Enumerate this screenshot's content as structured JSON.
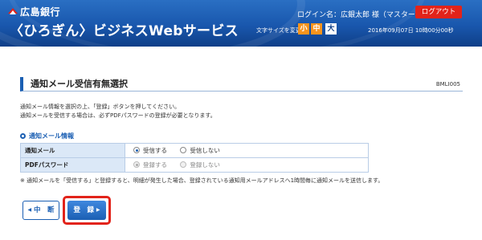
{
  "header": {
    "bank_name": "広島銀行",
    "service_name": "〈ひろぎん〉ビジネスWebサービス",
    "login_info": "ログイン名：広銀太郎 様（マスターユーザ）",
    "logout_label": "ログアウト",
    "font_size_label": "文字サイズを変更",
    "font_size_small": "小",
    "font_size_medium": "中",
    "font_size_large": "大",
    "datetime": "2016年09月07日 10時00分00秒"
  },
  "page": {
    "title": "通知メール受信有無選択",
    "screen_id": "BMLI005",
    "instruction_line1": "通知メール情報を選択の上、「登録」ボタンを押してください。",
    "instruction_line2": "通知メールを受信する場合は、必ずPDFパスワードの登録が必要となります。"
  },
  "section": {
    "heading": "通知メール情報"
  },
  "table": {
    "rows": [
      {
        "label": "通知メール",
        "options": [
          {
            "label": "受信する",
            "checked": true,
            "disabled": false
          },
          {
            "label": "受信しない",
            "checked": false,
            "disabled": false
          }
        ]
      },
      {
        "label": "PDFパスワード",
        "options": [
          {
            "label": "登録する",
            "checked": true,
            "disabled": true
          },
          {
            "label": "登録しない",
            "checked": false,
            "disabled": true
          }
        ]
      }
    ]
  },
  "note": "※ 通知メールを「受信する」と登録すると、明細が発生した場合、登録されている通知用メールアドレスへ1時間毎に通知メールを送信します。",
  "buttons": {
    "cancel_label": "中　断",
    "register_label": "登　録",
    "cancel_arrow": "◀",
    "register_arrow": "▶"
  },
  "colors": {
    "header_blue": "#1957ad",
    "accent_blue": "#1b5fb3",
    "logout_red": "#e2231a",
    "font_orange": "#f7941d",
    "highlight_red": "#e2231a"
  }
}
